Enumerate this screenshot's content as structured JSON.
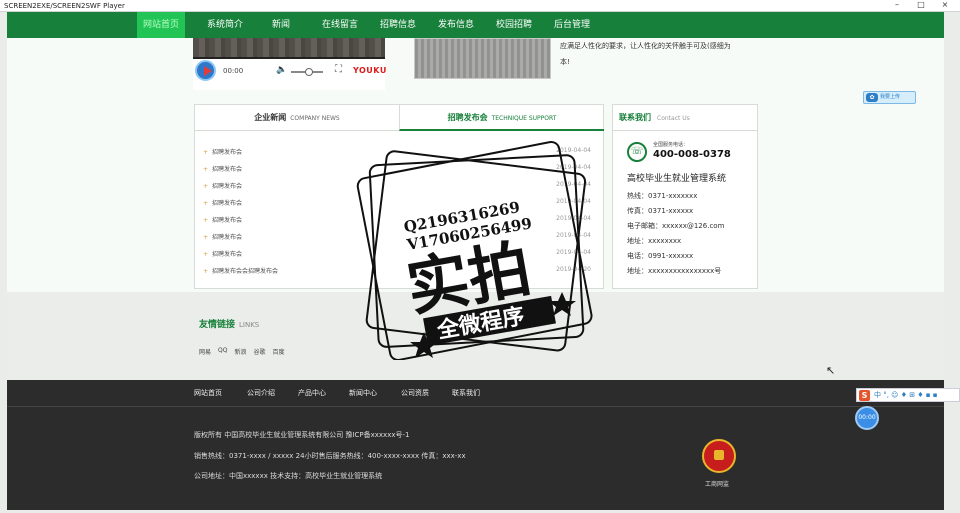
{
  "window": {
    "title": "SCREEN2EXE/SCREEN2SWF Player",
    "controls": [
      "–",
      "□",
      "×"
    ]
  },
  "nav": {
    "items": [
      "网站首页",
      "系统简介",
      "新闻",
      "在线留言",
      "招聘信息",
      "发布信息",
      "校园招聘",
      "后台管理"
    ],
    "active_index": 0
  },
  "video": {
    "time": "00:00",
    "brand": "YOUKU"
  },
  "about": {
    "text_line1": "应满足人性化的要求，让人性化的关怀触手可及(感细为",
    "text_line2": "本!"
  },
  "share": {
    "label": "我要上传"
  },
  "news": {
    "tab1": "企业新闻",
    "tab1_en": "COMPANY NEWS",
    "tab2": "招聘发布会",
    "tab2_en": "TECHNIQUE SUPPORT",
    "rows": [
      {
        "title": "招聘发布会",
        "date": "2019-04-04"
      },
      {
        "title": "招聘发布会",
        "date": "2019-04-04"
      },
      {
        "title": "招聘发布会",
        "date": "2019-04-04"
      },
      {
        "title": "招聘发布会",
        "date": "2019-04-04"
      },
      {
        "title": "招聘发布会",
        "date": "2019-04-04"
      },
      {
        "title": "招聘发布会",
        "date": "2019-04-04"
      },
      {
        "title": "招聘发布会",
        "date": "2019-04-04"
      },
      {
        "title": "招聘发布会会招聘发布会",
        "date": "2019-04-20"
      }
    ]
  },
  "contact": {
    "title": "联系我们",
    "title_en": "Contact Us",
    "hotline_label": "全国服务电话：",
    "hotline": "400-008-0378",
    "system_name": "高校毕业生就业管理系统",
    "lines": [
      "热线：0371-xxxxxxx",
      "传真：0371-xxxxxx",
      "电子邮箱：xxxxxx@126.com",
      "地址：xxxxxxxx",
      "电话：0991-xxxxxx",
      "地址：xxxxxxxxxxxxxxxx号"
    ]
  },
  "links": {
    "title": "友情链接",
    "title_en": "LINKS",
    "items": [
      "网易",
      "QQ",
      "新浪",
      "谷歌",
      "百度"
    ]
  },
  "footer": {
    "nav": [
      "网站首页",
      "公司介绍",
      "产品中心",
      "新闻中心",
      "公司资质",
      "联系我们"
    ],
    "copyright": "版权所有 中国高校毕业生就业管理系统有限公司 豫ICP备xxxxxx号-1",
    "sales": "销售热线：0371-xxxx / xxxxx 24小时售后服务热线：400-xxxx-xxxx 传真：xxx-xx",
    "address": "公司地址：中国xxxxxx 技术支持：高校毕业生就业管理系统",
    "emblem_label": "工商网监"
  },
  "stamp": {
    "line1": "Q2196316269",
    "line2": "V17060256499",
    "big": "实拍",
    "banner": "全微程序"
  },
  "ime": {
    "logo": "S",
    "label": "中 °, ☺ ♦ ⊞ ♦ ▪ ▪"
  },
  "timer": {
    "label": "00:00"
  }
}
